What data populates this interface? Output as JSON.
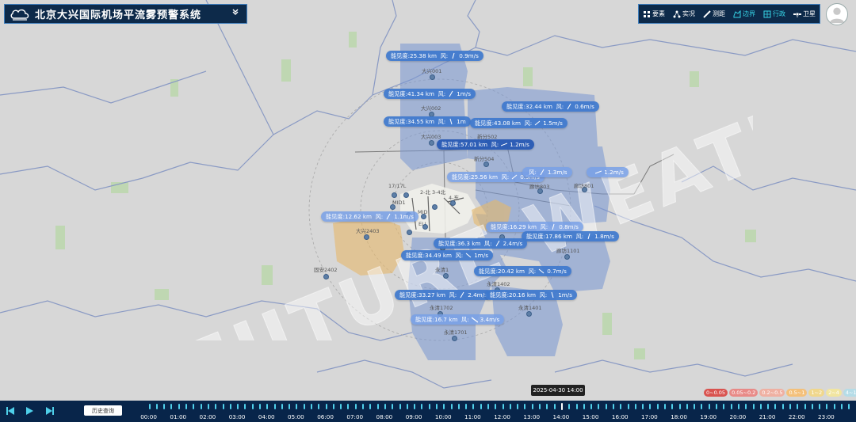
{
  "header": {
    "title": "北京大兴国际机场平流雾预警系统"
  },
  "toolbar": {
    "items": [
      {
        "label": "要素",
        "icon": "grid-icon",
        "active": false
      },
      {
        "label": "实况",
        "icon": "network-icon",
        "active": false
      },
      {
        "label": "测距",
        "icon": "ruler-icon",
        "active": false
      },
      {
        "label": "边界",
        "icon": "boundary-icon",
        "active": true
      },
      {
        "label": "行政",
        "icon": "admin-icon",
        "active": true
      },
      {
        "label": "卫星",
        "icon": "satellite-icon",
        "active": false
      }
    ]
  },
  "watermark": "FUTURE WEATHER",
  "map": {
    "labels": {
      "visibility_prefix": "能见度:",
      "wind_prefix": "风:"
    },
    "tags": [
      {
        "visibility": "25.38 km",
        "wind": "0.9m/s"
      },
      {
        "visibility": "41.34 km",
        "wind": "1m/s"
      },
      {
        "visibility": "32.44 km",
        "wind": "0.6m/s"
      },
      {
        "visibility": "34.55 km",
        "wind": "1m"
      },
      {
        "visibility": "43.08 km",
        "wind": "1.5m/s"
      },
      {
        "visibility": "57.01 km",
        "wind": "1.2m/s"
      },
      {
        "visibility": "25.56 km",
        "wind": "0.9m/s"
      },
      {
        "visibility": "",
        "wind": "1.3m/s"
      },
      {
        "visibility": "",
        "wind": "1.2m/s"
      },
      {
        "visibility": "12.62 km",
        "wind": "1.1m/s"
      },
      {
        "visibility": "16.29 km",
        "wind": "0.8m/s"
      },
      {
        "visibility": "17.86 km",
        "wind": "1.8m/s"
      },
      {
        "visibility": "36.3 km",
        "wind": "2.4m/s"
      },
      {
        "visibility": "34.49 km",
        "wind": "1m/s"
      },
      {
        "visibility": "20.42 km",
        "wind": "0.7m/s"
      },
      {
        "visibility": "33.27 km",
        "wind": "2.4m/s"
      },
      {
        "visibility": "20.16 km",
        "wind": "1m/s"
      },
      {
        "visibility": "16.7 km",
        "wind": "3.4m/s"
      }
    ],
    "stations": [
      "大兴001",
      "大兴002",
      "大兴003",
      "新分502",
      "新分504",
      "廊坊803",
      "廊坊801",
      "大兴2403",
      "固安2402",
      "廊坊1101",
      "永清1",
      "永清1402",
      "永清1702",
      "永清1401",
      "永清1701",
      "17/17L",
      "MID1",
      "MID",
      "ELL",
      "2-北",
      "3-4北",
      "4-东"
    ]
  },
  "legend": [
    {
      "label": "0~0.05",
      "color": "#d9534f"
    },
    {
      "label": "0.05~0.2",
      "color": "#e88a87"
    },
    {
      "label": "0.2~0.5",
      "color": "#efb0a2"
    },
    {
      "label": "0.5~1",
      "color": "#f4c07a"
    },
    {
      "label": "1~2",
      "color": "#f0d78c"
    },
    {
      "label": "2~4",
      "color": "#f1e5a0"
    },
    {
      "label": "4~10",
      "color": "#b5dce7"
    }
  ],
  "timeline": {
    "tooltip": "2025-04-30 14:00",
    "history_button": "历史查询",
    "hours": [
      "00:00",
      "01:00",
      "02:00",
      "03:00",
      "04:00",
      "05:00",
      "06:00",
      "07:00",
      "08:00",
      "09:00",
      "10:00",
      "11:00",
      "12:00",
      "13:00",
      "14:00",
      "15:00",
      "16:00",
      "17:00",
      "18:00",
      "19:00",
      "20:00",
      "21:00",
      "22:00",
      "23:00"
    ],
    "current_hour_index": 14
  },
  "colors": {
    "panel_bg": "#0d2a4a",
    "timeline_bg": "#08254a",
    "accent": "#37d6e8",
    "coverage": "#7896d2",
    "tag_bg": "#3e78cd",
    "fog": "#e6b86a"
  }
}
